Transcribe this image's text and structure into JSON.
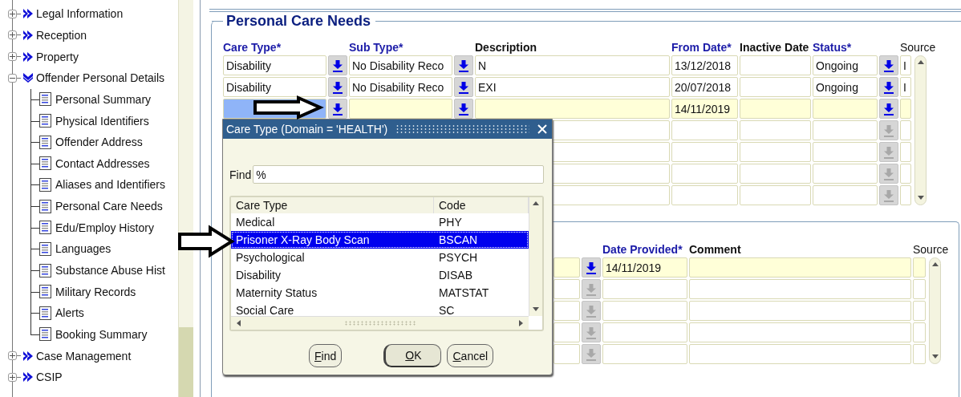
{
  "navigation_tree": [
    {
      "label": "Legal Information",
      "expanded": false
    },
    {
      "label": "Reception",
      "expanded": false
    },
    {
      "label": "Property",
      "expanded": false
    },
    {
      "label": "Offender Personal Details",
      "expanded": true,
      "children": [
        {
          "label": "Personal Summary"
        },
        {
          "label": "Physical Identifiers"
        },
        {
          "label": "Offender Address"
        },
        {
          "label": "Contact Addresses"
        },
        {
          "label": "Aliases and Identifiers"
        },
        {
          "label": "Personal Care Needs"
        },
        {
          "label": "Edu/Employ History"
        },
        {
          "label": "Languages"
        },
        {
          "label": "Substance Abuse Hist"
        },
        {
          "label": "Military Records"
        },
        {
          "label": "Alerts"
        },
        {
          "label": "Booking Summary"
        }
      ]
    },
    {
      "label": "Case Management",
      "expanded": false
    },
    {
      "label": "CSIP",
      "expanded": false
    }
  ],
  "personal_care_needs": {
    "title": "Personal Care Needs",
    "columns": [
      {
        "label": "Care Type*",
        "kind": "required"
      },
      {
        "label": "Sub Type*",
        "kind": "required"
      },
      {
        "label": "Description",
        "kind": "optional"
      },
      {
        "label": "From Date*",
        "kind": "required"
      },
      {
        "label": "Inactive Date",
        "kind": "optional"
      },
      {
        "label": "Status*",
        "kind": "required"
      },
      {
        "label": "Source",
        "kind": "info"
      }
    ],
    "rows": [
      {
        "care_type": "Disability",
        "sub_type": "No Disability Reco",
        "description": "N",
        "from_date": "13/12/2018",
        "status": "Ongoing",
        "source": "I",
        "current": false,
        "focused": false,
        "enabled": true
      },
      {
        "care_type": "Disability",
        "sub_type": "No Disability Reco",
        "description": "EXI",
        "from_date": "20/07/2018",
        "status": "Ongoing",
        "source": "I",
        "current": false,
        "focused": false,
        "enabled": true
      },
      {
        "from_date": "14/11/2019",
        "current": true,
        "focused": true,
        "enabled": true
      },
      {
        "current": false,
        "enabled": false
      },
      {
        "current": false,
        "enabled": false
      },
      {
        "current": false,
        "enabled": false
      },
      {
        "current": false,
        "enabled": false
      }
    ]
  },
  "section_2": {
    "columns": [
      {
        "label": "Date Provided*",
        "kind": "required"
      },
      {
        "label": "Comment",
        "kind": "optional"
      },
      {
        "label": "Source",
        "kind": "info"
      }
    ],
    "rows": [
      {
        "date_provided": "14/11/2019",
        "current": true,
        "enabled": true
      },
      {
        "current": false,
        "enabled": false
      },
      {
        "current": false,
        "enabled": false
      },
      {
        "current": false,
        "enabled": false
      },
      {
        "current": false,
        "enabled": false
      }
    ]
  },
  "dialog": {
    "title": "Care Type (Domain = 'HEALTH')",
    "find_label": "Find",
    "find_value": "%",
    "list_columns": [
      "Care Type",
      "Code"
    ],
    "items": [
      {
        "care_type": "Medical",
        "code": "PHY",
        "selected": false
      },
      {
        "care_type": "Prisoner X-Ray Body Scan",
        "code": "BSCAN",
        "selected": true
      },
      {
        "care_type": "Psychological",
        "code": "PSYCH",
        "selected": false
      },
      {
        "care_type": "Disability",
        "code": "DISAB",
        "selected": false
      },
      {
        "care_type": "Maternity Status",
        "code": "MATSTAT",
        "selected": false
      },
      {
        "care_type": "Social Care",
        "code": "SC",
        "selected": false
      }
    ],
    "buttons": [
      {
        "label": "Find",
        "default": false
      },
      {
        "label": "OK",
        "default": true
      },
      {
        "label": "Cancel",
        "default": false
      }
    ]
  }
}
